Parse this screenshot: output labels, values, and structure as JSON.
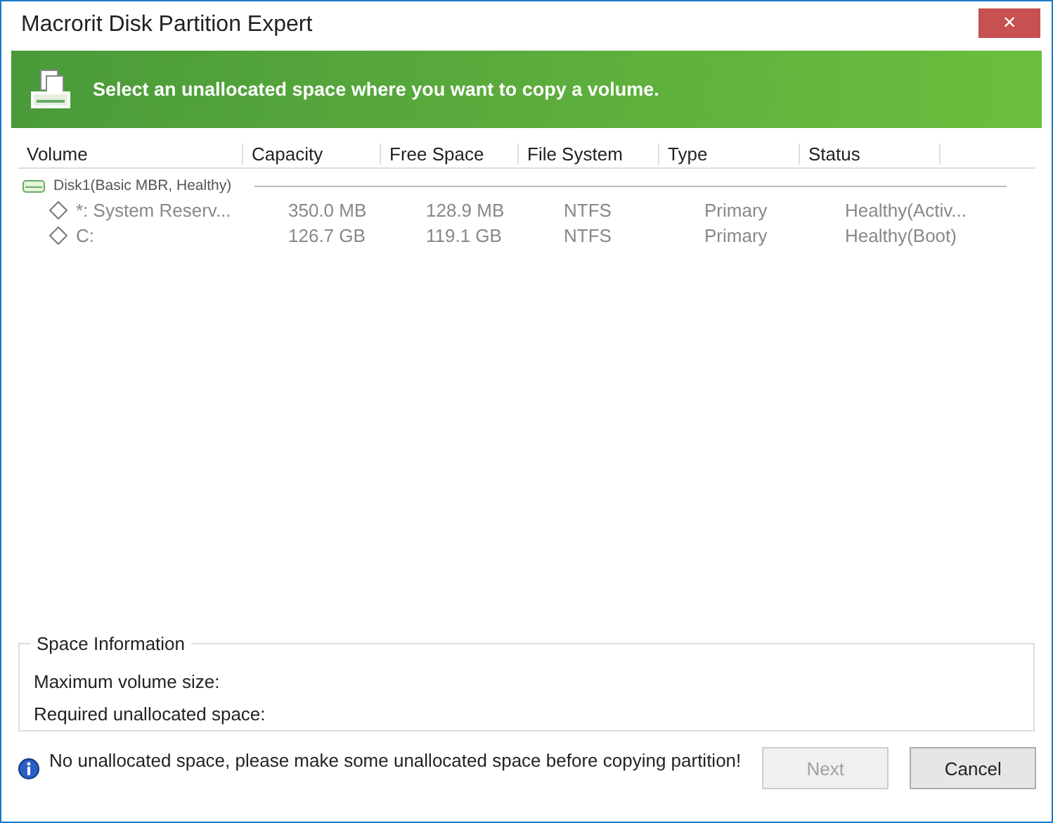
{
  "window": {
    "title": "Macrorit Disk Partition Expert",
    "close": "×"
  },
  "banner": {
    "text": "Select an unallocated space where you want to copy a volume."
  },
  "table": {
    "columns": [
      "Volume",
      "Capacity",
      "Free Space",
      "File System",
      "Type",
      "Status"
    ],
    "disks": [
      {
        "label": "Disk1(Basic MBR, Healthy)",
        "rows": [
          {
            "cells": [
              "*: System Reserv...",
              "350.0 MB",
              "128.9 MB",
              "NTFS",
              "Primary",
              "Healthy(Activ..."
            ],
            "disabled": true,
            "selected": false
          },
          {
            "cells": [
              "C:",
              "126.7 GB",
              "119.1 GB",
              "NTFS",
              "Primary",
              "Healthy(Boot)"
            ],
            "disabled": true,
            "selected": false
          }
        ]
      }
    ]
  },
  "space_information": {
    "title": "Space Information",
    "fields": [
      "Maximum volume size:",
      "Required unallocated space:"
    ]
  },
  "message": "No unallocated space, please make some unallocated space before copying partition!",
  "buttons": [
    {
      "label": "Next",
      "disabled": true
    },
    {
      "label": "Cancel",
      "disabled": false
    }
  ]
}
